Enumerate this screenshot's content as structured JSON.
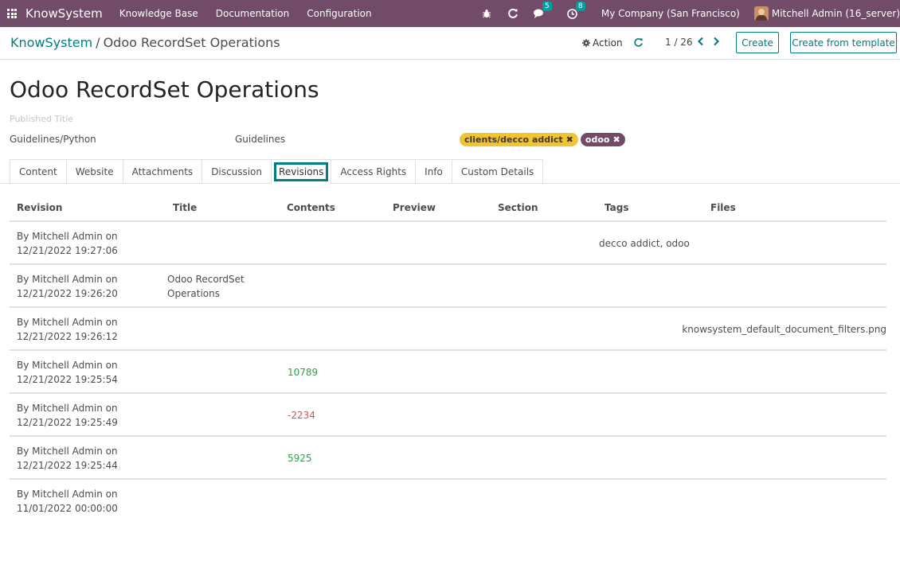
{
  "navbar": {
    "brand": "KnowSystem",
    "menu": [
      "Knowledge Base",
      "Documentation",
      "Configuration"
    ],
    "messages_count": "5",
    "activities_count": "8",
    "company": "My Company (San Francisco)",
    "user": "Mitchell Admin (16_server)"
  },
  "breadcrumb": {
    "parent": "KnowSystem",
    "separator": "/",
    "current": "Odoo RecordSet Operations"
  },
  "control": {
    "action_label": "Action",
    "pager": "1 / 26",
    "create_label": "Create",
    "create_template_label": "Create from template"
  },
  "form": {
    "title": "Odoo RecordSet Operations",
    "published_title_placeholder": "Published Title",
    "section": "Guidelines/Python",
    "type": "Guidelines",
    "tags": [
      {
        "label": "clients/decco addict",
        "color": "#f4c430"
      },
      {
        "label": "odoo",
        "color": "#714b67"
      }
    ]
  },
  "tabs": [
    "Content",
    "Website",
    "Attachments",
    "Discussion",
    "Revisions",
    "Access Rights",
    "Info",
    "Custom Details"
  ],
  "active_tab": "Revisions",
  "table": {
    "headers": [
      "Revision",
      "Title",
      "Contents",
      "Preview",
      "Section",
      "Tags",
      "Files"
    ],
    "rows": [
      {
        "revision": "By Mitchell Admin on 12/21/2022 19:27:06",
        "title": "",
        "contents": "",
        "tags": "decco addict, odoo",
        "files": ""
      },
      {
        "revision": "By Mitchell Admin on 12/21/2022 19:26:20",
        "title": "Odoo RecordSet Operations",
        "contents": "",
        "tags": "",
        "files": ""
      },
      {
        "revision": "By Mitchell Admin on 12/21/2022 19:26:12",
        "title": "",
        "contents": "",
        "tags": "",
        "files": "knowsystem_default_document_filters.png"
      },
      {
        "revision": "By Mitchell Admin on 12/21/2022 19:25:54",
        "title": "",
        "contents": "10789",
        "tags": "",
        "files": ""
      },
      {
        "revision": "By Mitchell Admin on 12/21/2022 19:25:49",
        "title": "",
        "contents": "-2234",
        "tags": "",
        "files": ""
      },
      {
        "revision": "By Mitchell Admin on 12/21/2022 19:25:44",
        "title": "",
        "contents": "5925",
        "tags": "",
        "files": ""
      },
      {
        "revision": "By Mitchell Admin on 11/01/2022 00:00:00",
        "title": "",
        "contents": "",
        "tags": "",
        "files": ""
      }
    ]
  },
  "colors": {
    "navbar": "#714b67",
    "accent": "#017e84",
    "positive": "#28a745",
    "negative": "#d9534f"
  }
}
